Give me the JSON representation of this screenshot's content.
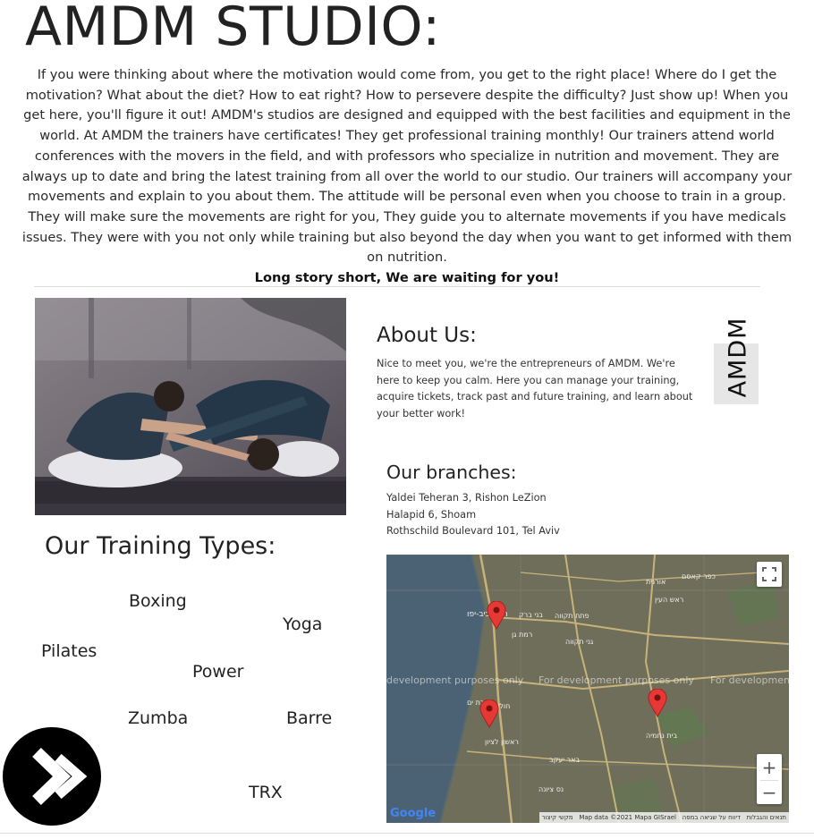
{
  "page": {
    "title": "AMDM STUDIO:",
    "intro": "If you were thinking about where the motivation would come from, you get to the right place! Where do I get the motivation? What about the diet? How to eat right? How to persevere despite the difficulty? Just show up! When you get here, you'll figure it out! AMDM's studios are designed and equipped with the best facilities and equipment in the world. At AMDM the trainers have certificates! They get professional training monthly! Our trainers attend world conferences with the movers in the field, and with professors who specialize in nutrition and movement. They are always up to date and bring the latest training from all over the world to our studio. Our trainers will accompany your movements and explain to you about them. The attitude will be personal even when you choose to train in a group. They will make sure the movements are right for you, They guide you to alternate movements if you have medicals issues. They were with you not only while training but also beyond the day when you want to get informed with them on nutrition.",
    "intro_strong": "Long story short, We are waiting for you!"
  },
  "about": {
    "title": "About Us:",
    "text": "Nice to meet you, we're the entrepreneurs of AMDM. We're here to keep you calm. Here you can manage your training, acquire tickets, track past and future training, and learn about your better work!",
    "badge": "AMDM"
  },
  "branches": {
    "title": "Our branches:",
    "items": [
      "Yaldei Teheran 3, Rishon LeZion",
      "Halapid 6, Shoam",
      "Rothschild Boulevard 101, Tel Aviv"
    ]
  },
  "training": {
    "title": "Our Training Types:",
    "types": [
      "Boxing",
      "Yoga",
      "Pilates",
      "Power",
      "Zumba",
      "Barre",
      "TRX"
    ]
  },
  "map": {
    "dev_watermark": "For development purposes only",
    "dev_left": "development purposes only",
    "dev_right": "For development",
    "attribution": "Map data ©2021 Mapa GISrael",
    "attrib_terms": "תנאים והגבלות",
    "attrib_report": "דיווח על שגיאה במפה",
    "attrib_shortcuts": "מקשי קיצור",
    "google": "Google",
    "zoom_in": "+",
    "zoom_out": "−",
    "cities": [
      "תל אביב-יפו",
      "בני ברק",
      "פתח תקווה",
      "רמת גן",
      "ראש העין",
      "בת ים",
      "חולון",
      "ראשון לציון",
      "נס ציונה",
      "באר יעקב",
      "בית נחמיה",
      "גני תקווה",
      "אורנית",
      "כפר קאסם"
    ],
    "colors": {
      "water": "#4a6274",
      "land": "#6e6e5b",
      "road": "#c7b37a",
      "pin": "#e53935"
    }
  },
  "icons": {
    "fullscreen": "fullscreen-icon",
    "fab": "double-chevron-right-icon",
    "pin": "map-pin-icon"
  }
}
